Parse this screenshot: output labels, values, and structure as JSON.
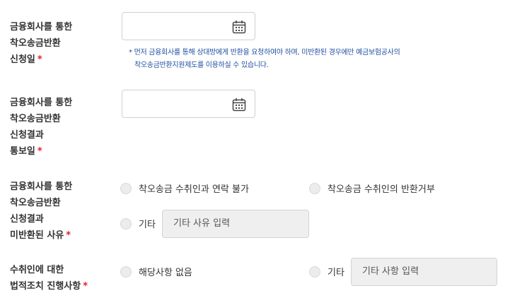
{
  "required_mark": "*",
  "fields": {
    "request_date": {
      "label_lines": [
        "금융회사를 통한",
        "착오송금반환",
        "신청일"
      ],
      "value": "",
      "calendar_icon": "calendar-icon",
      "note_lines": [
        "* 먼저 금융회사를 통해 상대방에게 반환을 요청하여야 하며, 미반환된 경우에만 예금보험공사의",
        "착오송금반환지원제도를 이용하실 수 있습니다."
      ]
    },
    "result_notice_date": {
      "label_lines": [
        "금융회사를 통한",
        "착오송금반환",
        "신청결과",
        "통보일"
      ],
      "value": "",
      "calendar_icon": "calendar-icon"
    },
    "non_return_reason": {
      "label_lines": [
        "금융회사를 통한",
        "착오송금반환",
        "신청결과",
        "미반환된 사유"
      ],
      "options": [
        "착오송금 수취인과 연락 불가",
        "착오송금 수취인의 반환거부",
        "기타"
      ],
      "other_placeholder": "기타 사유 입력"
    },
    "legal_action": {
      "label_lines": [
        "수취인에 대한",
        "법적조치 진행사항"
      ],
      "options": [
        "해당사항 없음",
        "기타"
      ],
      "other_placeholder": "기타 사항 입력"
    }
  },
  "colors": {
    "required": "#e0202a",
    "note_text": "#1f4fa0",
    "radio_fill": "#ececec",
    "disabled_field": "#efefef"
  }
}
